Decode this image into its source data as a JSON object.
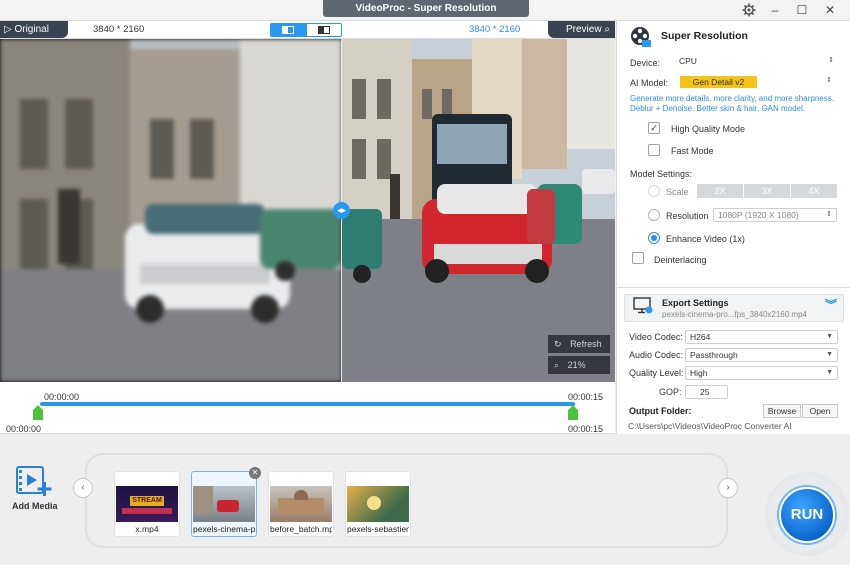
{
  "app": {
    "title": "VideoProc  -  Super Resolution"
  },
  "window": {
    "settings_icon": "gear-icon",
    "minimize": "–",
    "maximize": "☐",
    "close": "✕"
  },
  "preview": {
    "original_label": "▷ Original",
    "preview_label": "Preview",
    "res_left": "3840 * 2160",
    "res_right": "3840 * 2160",
    "refresh_label": "Refresh",
    "zoom_label": "21%",
    "split_handle": "◂▸",
    "split_position_pct": 55.6
  },
  "timeline": {
    "start_time": "00:00:00",
    "end_time": "00:00:15",
    "in_time": "00:00:00",
    "out_time": "00:00:15"
  },
  "panel": {
    "title": "Super Resolution",
    "device_label": "Device:",
    "device_value": "CPU",
    "model_label": "AI Model:",
    "model_value": "Gen Detail v2",
    "description": "Generate more details, more clarity, and more sharpness. Deblur + Denoise. Better skin & hair. GAN model.",
    "hq_mode": "High Quality Mode",
    "hq_checked": "✓",
    "fast_mode": "Fast Mode",
    "model_settings": "Model Settings:",
    "scale_label": "Scale",
    "scale_options": [
      "2X",
      "3X",
      "4X"
    ],
    "resolution_label": "Resolution",
    "resolution_value": "1080P (1920 X 1080)",
    "enhance_label": "Enhance Video (1x)",
    "deinterlacing": "Deinterlacing",
    "export_title": "Export Settings",
    "export_file": "pexels-cinema-pro...fps_3840x2160.mp4",
    "video_codec_label": "Video Codec:",
    "video_codec": "H264",
    "audio_codec_label": "Audio Codec:",
    "audio_codec": "Passthrough",
    "quality_label": "Quality Level:",
    "quality": "High",
    "gop_label": "GOP:",
    "gop": "25",
    "output_label": "Output Folder:",
    "browse": "Browse",
    "open": "Open",
    "output_path": "C:\\Users\\pc\\Videos\\VideoProc Converter AI"
  },
  "media": {
    "add_label": "Add Media",
    "items": [
      {
        "name": "x.mp4",
        "overlay": "STREAM"
      },
      {
        "name": "pexels-cinema-pr"
      },
      {
        "name": "before_batch.mp"
      },
      {
        "name": "pexels-sebastien"
      }
    ],
    "prev": "‹",
    "next": "›",
    "remove": "✕"
  },
  "run": {
    "label": "RUN"
  },
  "colors": {
    "accent": "#2a97f0",
    "model_badge": "#f4c21a",
    "timeline_marker": "#4cc23b"
  }
}
